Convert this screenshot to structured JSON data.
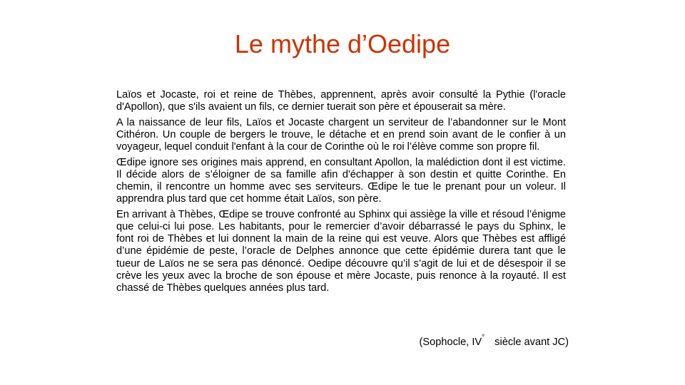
{
  "slide": {
    "title": "Le mythe d’Oedipe",
    "title_color": "#cc3300",
    "paragraphs": [
      "Laïos et Jocaste, roi et reine de Thèbes, apprennent, après avoir consulté la Pythie (l'oracle d'Apollon), que s'ils avaient un fils, ce dernier tuerait son père et épouserait sa mère.",
      "A la naissance de leur fils, Laïos et Jocaste chargent un serviteur de l’abandonner sur le Mont Cithéron. Un couple de bergers le trouve, le détache et en prend soin avant de le confier à un voyageur, lequel conduit l'enfant à la cour de Corinthe où le roi l’élève comme son propre fil.",
      "Œdipe ignore ses origines mais apprend, en consultant Apollon, la malédiction dont il est victime. Il décide alors de s’éloigner de sa famille afin d'échapper à son destin et quitte Corinthe. En chemin, il rencontre un homme avec ses serviteurs. Œdipe le tue le prenant pour un voleur. Il apprendra plus tard que cet homme était Laïos, son père.",
      "En arrivant à Thèbes, Œdipe se trouve confronté au Sphinx qui assiège la ville et résoud l’énigme que celui-ci lui pose. Les habitants, pour le remercier d’avoir débarrassé le pays du Sphinx, le font roi de Thèbes et lui donnent la main de la reine qui est veuve. Alors que Thèbes est affligé d’une épidémie de peste, l’oracle de Delphes annonce que cette épidémie durera tant que le tueur de Laïos ne se sera pas dénoncé. Oedipe découvre qu’il s’agit de lui et de désespoir il se crève les yeux avec la broche de son épouse et mère Jocaste, puis renonce à la royauté. Il est chassé de Thèbes quelques années plus tard."
    ],
    "citation": {
      "prefix": "(Sophocle, IV",
      "superscript": "°",
      "suffix": "siècle avant JC)"
    }
  }
}
